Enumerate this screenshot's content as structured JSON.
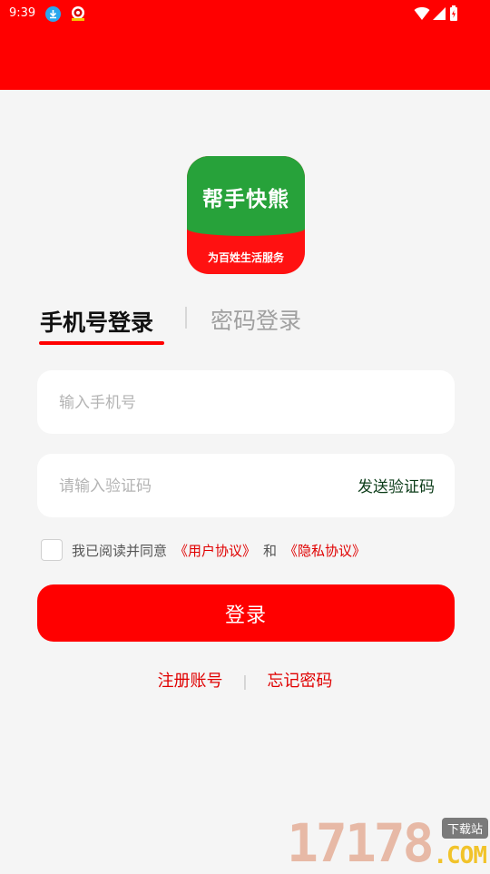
{
  "status_bar": {
    "time": "9:39",
    "icons": [
      "download-icon",
      "app-notification-icon",
      "wifi-icon",
      "signal-icon",
      "battery-icon"
    ]
  },
  "logo": {
    "main_text": "帮手快熊",
    "sub_text": "为百姓生活服务"
  },
  "tabs": {
    "active": "手机号登录",
    "inactive": "密码登录"
  },
  "form": {
    "phone_placeholder": "输入手机号",
    "code_placeholder": "请输入验证码",
    "send_code_label": "发送验证码"
  },
  "agreement": {
    "prefix": "我已阅读并同意",
    "user_agreement": "《用户协议》",
    "and": "和",
    "privacy_agreement": "《隐私协议》",
    "checked": false
  },
  "login_button": "登录",
  "links": {
    "register": "注册账号",
    "forgot": "忘记密码"
  },
  "watermark": {
    "number": "17178",
    "tag": "下载站",
    "domain": ".COM"
  },
  "colors": {
    "brand_red": "#ff0000",
    "link_red": "#e00000",
    "logo_green": "#27a23a",
    "send_code_green": "#0c3d19"
  }
}
